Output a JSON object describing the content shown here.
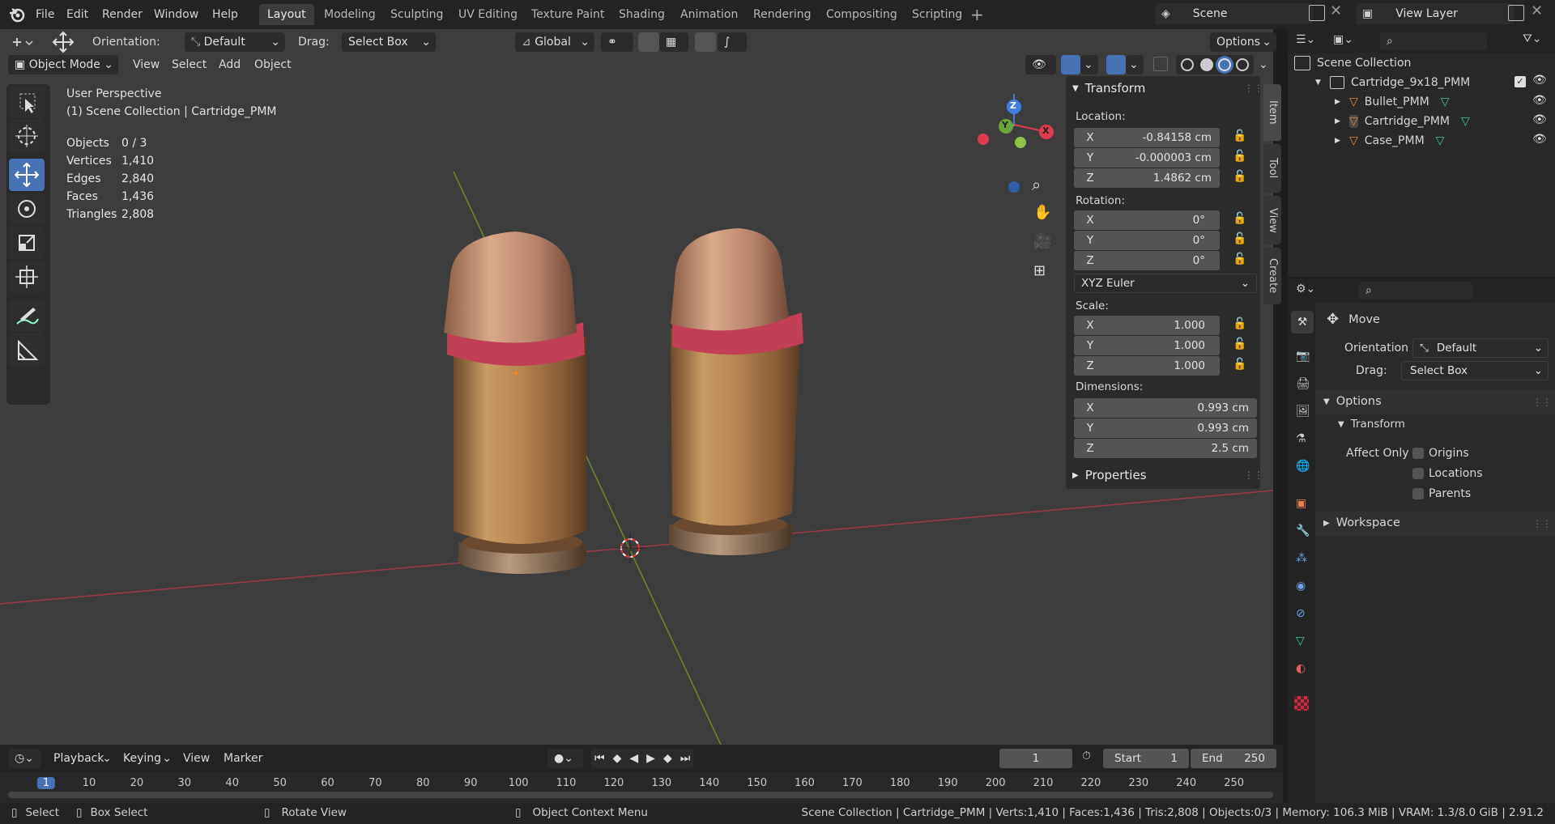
{
  "app": {
    "menus": [
      "File",
      "Edit",
      "Render",
      "Window",
      "Help"
    ],
    "workspaces": [
      "Layout",
      "Modeling",
      "Sculpting",
      "UV Editing",
      "Texture Paint",
      "Shading",
      "Animation",
      "Rendering",
      "Compositing",
      "Scripting"
    ],
    "active_workspace": "Layout",
    "scene_label": "Scene",
    "view_layer_label": "View Layer"
  },
  "tool_header": {
    "orientation_label": "Orientation:",
    "orientation_value": "Default",
    "drag_label": "Drag:",
    "drag_value": "Select Box",
    "transform_orientation": "Global",
    "options_label": "Options"
  },
  "viewport_header": {
    "mode": "Object Mode",
    "menus": [
      "View",
      "Select",
      "Add",
      "Object"
    ]
  },
  "viewport": {
    "view_name": "User Perspective",
    "collection_line": "(1) Scene Collection | Cartridge_PMM",
    "stats": [
      {
        "label": "Objects",
        "value": "0 / 3"
      },
      {
        "label": "Vertices",
        "value": "1,410"
      },
      {
        "label": "Edges",
        "value": "2,840"
      },
      {
        "label": "Faces",
        "value": "1,436"
      },
      {
        "label": "Triangles",
        "value": "2,808"
      }
    ],
    "gizmo_axes": {
      "x": "X",
      "y": "Y",
      "z": "Z"
    }
  },
  "npanel": {
    "tabs": [
      "Item",
      "Tool",
      "View",
      "Create"
    ],
    "transform_title": "Transform",
    "location_label": "Location:",
    "location": [
      {
        "axis": "X",
        "value": "-0.84158 cm"
      },
      {
        "axis": "Y",
        "value": "-0.000003 cm"
      },
      {
        "axis": "Z",
        "value": "1.4862 cm"
      }
    ],
    "rotation_label": "Rotation:",
    "rotation": [
      {
        "axis": "X",
        "value": "0°"
      },
      {
        "axis": "Y",
        "value": "0°"
      },
      {
        "axis": "Z",
        "value": "0°"
      }
    ],
    "rotation_mode": "XYZ Euler",
    "scale_label": "Scale:",
    "scale": [
      {
        "axis": "X",
        "value": "1.000"
      },
      {
        "axis": "Y",
        "value": "1.000"
      },
      {
        "axis": "Z",
        "value": "1.000"
      }
    ],
    "dimensions_label": "Dimensions:",
    "dimensions": [
      {
        "axis": "X",
        "value": "0.993 cm"
      },
      {
        "axis": "Y",
        "value": "0.993 cm"
      },
      {
        "axis": "Z",
        "value": "2.5 cm"
      }
    ],
    "properties_title": "Properties"
  },
  "outliner": {
    "root": "Scene Collection",
    "collection": "Cartridge_9x18_PMM",
    "objects": [
      "Bullet_PMM",
      "Cartridge_PMM",
      "Case_PMM"
    ]
  },
  "properties": {
    "tool_name": "Move",
    "orientation_label": "Orientation",
    "orientation_value": "Default",
    "drag_label": "Drag:",
    "drag_value": "Select Box",
    "options_title": "Options",
    "transform_title": "Transform",
    "affect_only_label": "Affect Only",
    "affect_options": [
      "Origins",
      "Locations",
      "Parents"
    ],
    "workspace_title": "Workspace"
  },
  "timeline": {
    "menus": [
      "Playback",
      "Keying",
      "View",
      "Marker"
    ],
    "current_frame": "1",
    "start_label": "Start",
    "start_value": "1",
    "end_label": "End",
    "end_value": "250",
    "ruler": [
      "1",
      "10",
      "20",
      "30",
      "40",
      "50",
      "60",
      "70",
      "80",
      "90",
      "100",
      "110",
      "120",
      "130",
      "140",
      "150",
      "160",
      "170",
      "180",
      "190",
      "200",
      "210",
      "220",
      "230",
      "240",
      "250"
    ]
  },
  "statusbar": {
    "select": "Select",
    "box_select": "Box Select",
    "rotate_view": "Rotate View",
    "context_menu": "Object Context Menu",
    "stats": "Scene Collection | Cartridge_PMM | Verts:1,410 | Faces:1,436 | Tris:2,808 | Objects:0/3 | Memory: 106.3 MiB | VRAM: 1.3/8.0 GiB | 2.91.2"
  },
  "colors": {
    "accent": "#4772b3",
    "axis_x": "#e03a4f",
    "axis_y": "#8bc34a",
    "axis_z": "#3d7ee0",
    "object_orange": "#e8833a",
    "mesh_green": "#3fc98a"
  }
}
